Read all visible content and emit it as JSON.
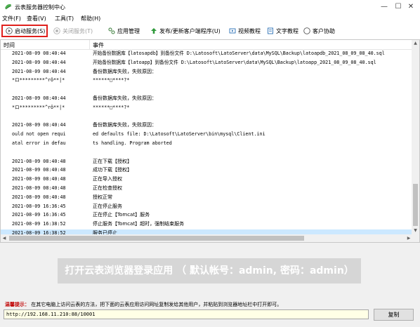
{
  "window": {
    "title": "云表服务器控制中心",
    "minimize": "—",
    "maximize": "☐",
    "close": "✕"
  },
  "menu": [
    "文件(F)",
    "查看(V)",
    "工具(T)",
    "帮助(H)"
  ],
  "toolbar": {
    "start": "启动服务(S)",
    "stop": "关闭服务(T)",
    "apps": "应用管理",
    "publish": "发布/更新客户端程序(U)",
    "video": "视频教程",
    "text_tutorial": "文字教程",
    "support": "客户协助"
  },
  "log": {
    "col_time": "时间",
    "col_event": "事件",
    "rows": [
      {
        "time": "2021-08-09 08:40:44",
        "event": "开始备份数据库【latosapdb】到备份文件 D:\\Latosoft\\LatoServer\\data\\MySQL\\Backup\\latoapdb_2021_08_09_08_40.sql"
      },
      {
        "time": "2021-08-09 08:40:44",
        "event": "开始备份数据库【latoapp】到备份文件 D:\\Latosoft\\LatoServer\\data\\MySQL\\Backup\\latoapp_2021_08_09_08_40.sql"
      },
      {
        "time": "2021-08-09 08:40:44",
        "event": "备份数据库失败，失败原因："
      },
      {
        "time": "*ロ*********^rô**|*",
        "event": "******□****?*"
      },
      {
        "time": "",
        "event": ""
      },
      {
        "time": "2021-08-09 08:40:44",
        "event": "备份数据库失败，失败原因："
      },
      {
        "time": "*ロ*********^rô**|*",
        "event": "******□****?*"
      },
      {
        "time": "",
        "event": ""
      },
      {
        "time": "2021-08-09 08:40:44",
        "event": "备份数据库失败，失败原因："
      },
      {
        "time": "ould not open requi",
        "event": "ed defaults file: D:\\Latosoft\\LatoServer\\bin\\mysql\\Client.ini"
      },
      {
        "time": "atal error in defau",
        "event": "ts handling. Program aborted"
      },
      {
        "time": "",
        "event": ""
      },
      {
        "time": "2021-08-09 08:40:48",
        "event": "正在下载【授权】"
      },
      {
        "time": "2021-08-09 08:40:48",
        "event": "成功下载【授权】"
      },
      {
        "time": "2021-08-09 08:40:48",
        "event": "正在导入授权"
      },
      {
        "time": "2021-08-09 08:40:48",
        "event": "正在检查授权"
      },
      {
        "time": "2021-08-09 08:40:48",
        "event": "授权正常"
      },
      {
        "time": "2021-08-09 16:36:45",
        "event": "正在停止服务"
      },
      {
        "time": "2021-08-09 16:36:45",
        "event": "正在停止【Tomcat】服务"
      },
      {
        "time": "2021-08-09 16:38:52",
        "event": "停止服务【Tomcat】超时，强制结束服务"
      },
      {
        "time": "2021-08-09 16:38:52",
        "event": "服务已停止"
      }
    ]
  },
  "banner": "打开云表浏览器登录应用 （ 默认帐号：admin, 密码：admin）",
  "tip": {
    "label": "温馨提示：",
    "text": "在其它电脑上访问云表的方法，把下面的云表应用访问网址复制发给其他用户，并粘贴到浏览器地址栏中打开即可。"
  },
  "url": "http://192.168.11.210:88/10001",
  "copy_button": "复制",
  "colors": {
    "accent_red": "#e0201c",
    "selected_row": "#cce8ff",
    "tip_red": "#c00000"
  }
}
